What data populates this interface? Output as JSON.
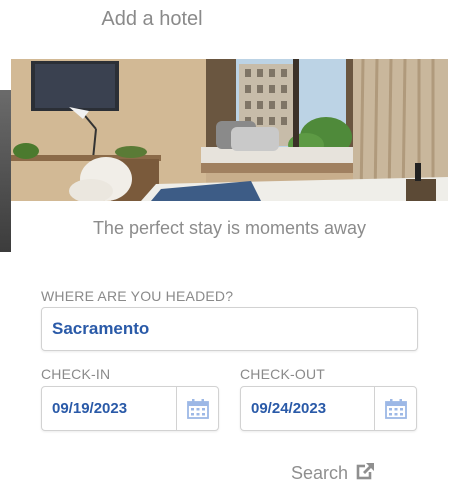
{
  "header": {
    "title": "Add a hotel"
  },
  "hero": {
    "tagline": "The perfect stay is moments away"
  },
  "form": {
    "destination_label": "WHERE ARE YOU HEADED?",
    "destination_value": "Sacramento",
    "checkin_label": "CHECK-IN",
    "checkin_value": "09/19/2023",
    "checkout_label": "CHECK-OUT",
    "checkout_value": "09/24/2023",
    "search_label": "Search"
  },
  "icons": {
    "calendar": "calendar-icon",
    "external": "external-link-icon"
  },
  "colors": {
    "value_text": "#2a5aa8",
    "label_text": "#8a8a8a",
    "calendar_icon": "#9db8e6"
  }
}
